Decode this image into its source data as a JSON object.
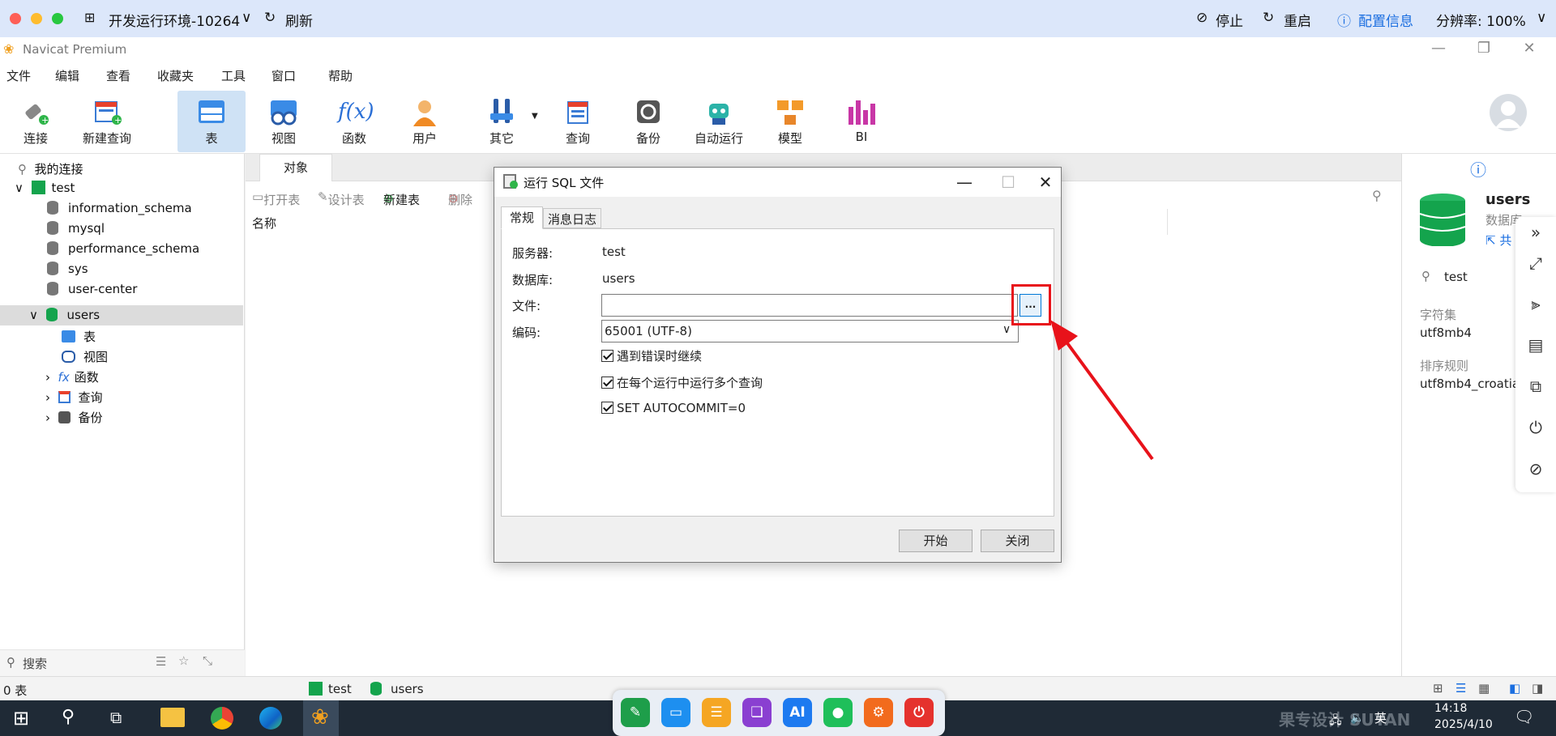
{
  "host": {
    "env_title": "开发运行环境-10264",
    "refresh": "刷新",
    "stop": "停止",
    "restart": "重启",
    "config_info": "配置信息",
    "resolution": "分辨率: 100%"
  },
  "app": {
    "title": "Navicat Premium",
    "menu": [
      "文件",
      "编辑",
      "查看",
      "收藏夹",
      "工具",
      "窗口",
      "帮助"
    ],
    "toolbar": [
      "连接",
      "新建查询",
      "表",
      "视图",
      "函数",
      "用户",
      "其它",
      "查询",
      "备份",
      "自动运行",
      "模型",
      "BI"
    ]
  },
  "sidebar": {
    "header": "我的连接",
    "connection": "test",
    "databases": [
      "information_schema",
      "mysql",
      "performance_schema",
      "sys",
      "user-center",
      "users"
    ],
    "children": [
      "表",
      "视图",
      "函数",
      "查询",
      "备份"
    ],
    "search_placeholder": "搜索"
  },
  "center": {
    "tab": "对象",
    "actions": [
      "打开表",
      "设计表",
      "新建表",
      "删除"
    ],
    "column_name": "名称"
  },
  "right_panel": {
    "db_name": "users",
    "db_type": "数据库",
    "share": "共",
    "connection": "test",
    "charset_label": "字符集",
    "charset_value": "utf8mb4",
    "collation_label": "排序规则",
    "collation_value": "utf8mb4_croatia"
  },
  "dialog": {
    "title": "运行 SQL 文件",
    "tabs": [
      "常规",
      "消息日志"
    ],
    "server_label": "服务器:",
    "server_value": "test",
    "db_label": "数据库:",
    "db_value": "users",
    "file_label": "文件:",
    "file_value": "",
    "browse": "...",
    "encoding_label": "编码:",
    "encoding_value": "65001 (UTF-8)",
    "options": [
      "遇到错误时继续",
      "在每个运行中运行多个查询",
      "SET AUTOCOMMIT=0"
    ],
    "start": "开始",
    "close": "关闭"
  },
  "statusbar": {
    "count": "0 表",
    "connection": "test",
    "database": "users"
  },
  "taskbar": {
    "time": "14:18",
    "date": "2025/4/10",
    "ime": "英",
    "dock_ai": "AI"
  },
  "colors": {
    "accent": "#1a6ee0",
    "highlight_red": "#e8121a",
    "db_green": "#14a44d"
  }
}
